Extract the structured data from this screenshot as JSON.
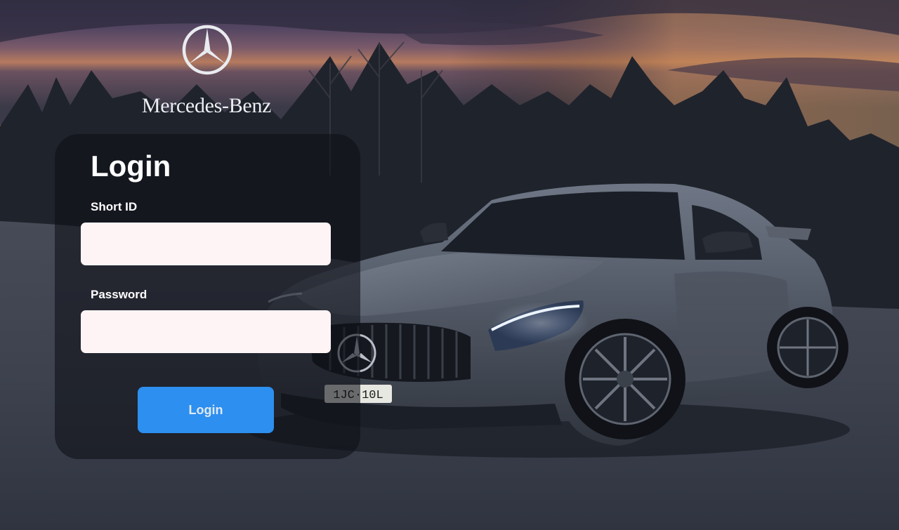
{
  "brand": {
    "name": "Mercedes-Benz",
    "logo_icon": "mercedes-star-icon"
  },
  "background": {
    "image": "mercedes-amg-gt-r-sunset-photo",
    "plate_text": "1JC·10L"
  },
  "login": {
    "title": "Login",
    "short_id_label": "Short ID",
    "short_id_value": "",
    "password_label": "Password",
    "password_value": "",
    "submit_label": "Login"
  },
  "colors": {
    "button": "#2d8fef",
    "input_bg": "#fff4f5",
    "panel_bg": "rgba(14,16,22,0.58)"
  }
}
